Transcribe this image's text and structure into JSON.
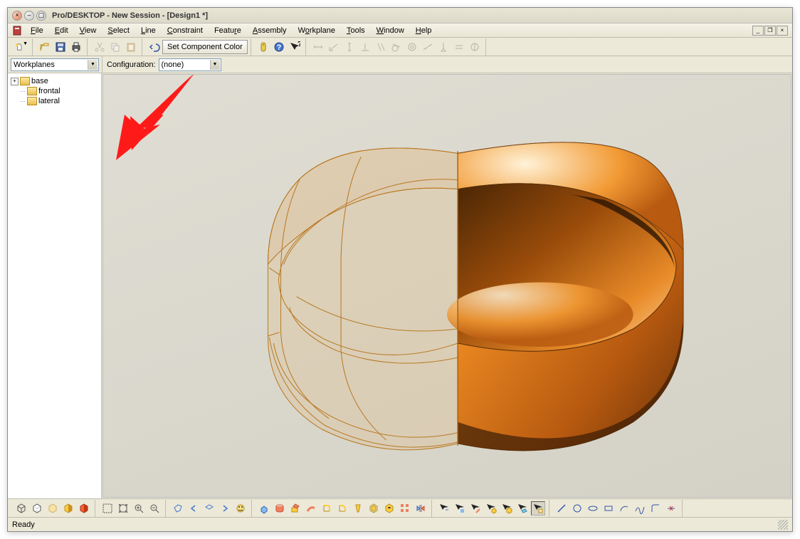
{
  "titlebar": {
    "title": "Pro/DESKTOP - New Session - [Design1 *]"
  },
  "menubar": {
    "items": [
      "File",
      "Edit",
      "View",
      "Select",
      "Line",
      "Constraint",
      "Feature",
      "Assembly",
      "Workplane",
      "Tools",
      "Window",
      "Help"
    ]
  },
  "toolbar1": {
    "set_component_color": "Set Component Color"
  },
  "panel_selector": {
    "value": "Workplanes"
  },
  "configuration": {
    "label": "Configuration:",
    "value": "(none)"
  },
  "tree": {
    "items": [
      {
        "name": "base",
        "expandable": true
      },
      {
        "name": "frontal",
        "expandable": false
      },
      {
        "name": "lateral",
        "expandable": false
      }
    ]
  },
  "statusbar": {
    "text": "Ready"
  }
}
